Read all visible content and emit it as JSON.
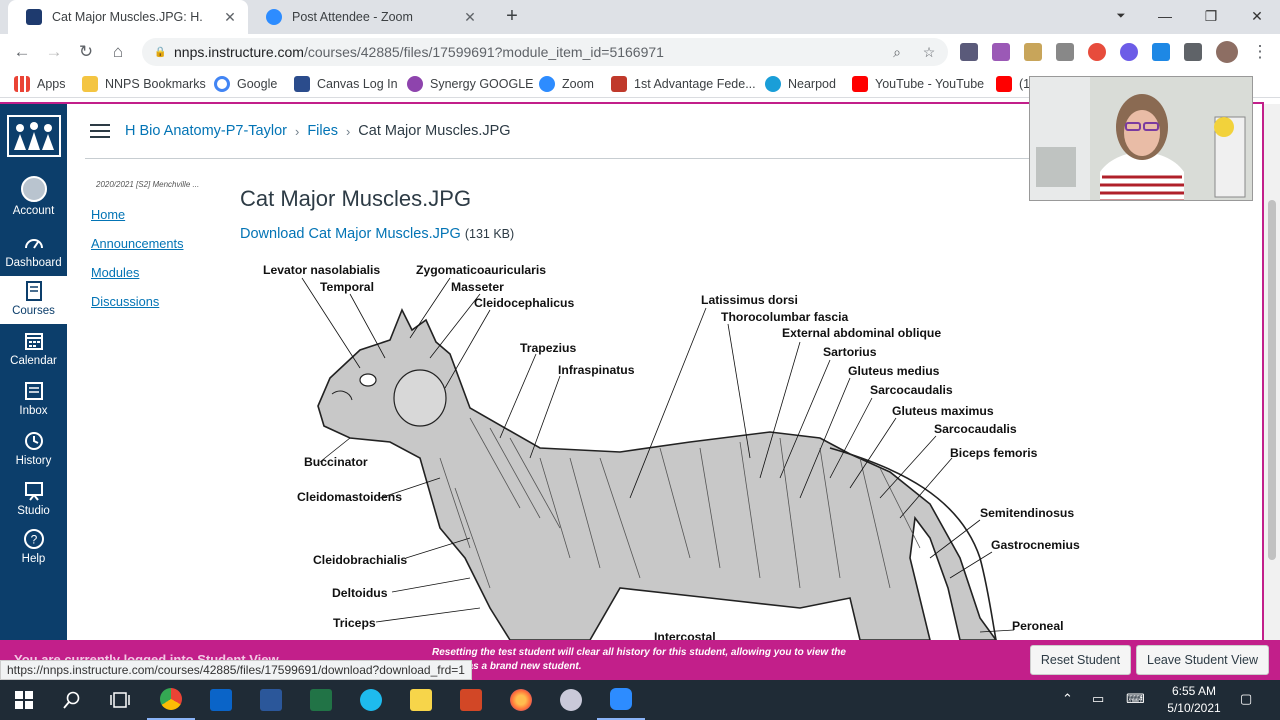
{
  "browser": {
    "tabs": [
      {
        "title": "Cat Major Muscles.JPG: H.Anaton",
        "active": true,
        "icon": "canvas-favicon"
      },
      {
        "title": "Post Attendee - Zoom",
        "active": false,
        "icon": "zoom-favicon"
      }
    ],
    "new_tab": "+",
    "window": {
      "minimize": "—",
      "restore": "❐",
      "close": "✕"
    },
    "url_host": "nnps.instructure.com",
    "url_path": "/courses/42885/files/17599691?module_item_id=5166971",
    "bookmarks": [
      {
        "label": "Apps",
        "color": "#ea4335"
      },
      {
        "label": "NNPS Bookmarks",
        "color": "#f4c542"
      },
      {
        "label": "Google",
        "color": "#4285f4"
      },
      {
        "label": "Canvas Log In",
        "color": "#2b4c8c"
      },
      {
        "label": "Synergy GOOGLE",
        "color": "#8e44ad"
      },
      {
        "label": "Zoom",
        "color": "#2d8cff"
      },
      {
        "label": "1st Advantage Fede...",
        "color": "#c0392b"
      },
      {
        "label": "Nearpod",
        "color": "#1a9ed8"
      },
      {
        "label": "YouTube - YouTube",
        "color": "#ff0000"
      },
      {
        "label": "(1",
        "color": "#ff0000"
      }
    ]
  },
  "global_nav": [
    {
      "label": "Account",
      "icon": "account-avatar-icon"
    },
    {
      "label": "Dashboard",
      "icon": "dashboard-icon"
    },
    {
      "label": "Courses",
      "icon": "courses-icon",
      "active": true
    },
    {
      "label": "Calendar",
      "icon": "calendar-icon"
    },
    {
      "label": "Inbox",
      "icon": "inbox-icon"
    },
    {
      "label": "History",
      "icon": "history-icon"
    },
    {
      "label": "Studio",
      "icon": "studio-icon"
    },
    {
      "label": "Help",
      "icon": "help-icon"
    }
  ],
  "breadcrumbs": {
    "course": "H Bio Anatomy-P7-Taylor",
    "section": "Files",
    "current": "Cat Major Muscles.JPG",
    "separator": "›"
  },
  "course_nav": {
    "term": "2020/2021 [S2] Menchville ...",
    "items": [
      "Home",
      "Announcements",
      "Modules",
      "Discussions"
    ]
  },
  "file": {
    "title": "Cat Major Muscles.JPG",
    "download_label": "Download Cat Major Muscles.JPG",
    "size": "(131 KB)"
  },
  "muscle_labels": [
    "Levator nasolabialis",
    "Temporal",
    "Zygomaticoauricularis",
    "Masseter",
    "Cleidocephalicus",
    "Trapezius",
    "Infraspinatus",
    "Buccinator",
    "Cleidomastoidens",
    "Cleidobrachialis",
    "Deltoidus",
    "Triceps",
    "Intercostal",
    "Latissimus dorsi",
    "Thorocolumbar fascia",
    "External abdominal oblique",
    "Sartorius",
    "Gluteus medius",
    "Sarcocaudalis",
    "Gluteus maximus",
    "Sarcocaudalis",
    "Biceps femoris",
    "Semitendinosus",
    "Gastrocnemius",
    "Peroneal"
  ],
  "student_view": {
    "ghost_text": "You are currently logged into Student View",
    "message": "Resetting the test student will clear all history for this student, allowing you to view the course as a brand new student.",
    "reset_button": "Reset Student",
    "leave_button": "Leave Student View"
  },
  "status_url": "https://nnps.instructure.com/courses/42885/files/17599691/download?download_frd=1",
  "taskbar": {
    "time": "6:55 AM",
    "date": "5/10/2021",
    "apps": [
      {
        "name": "start",
        "color": "#ffffff"
      },
      {
        "name": "search",
        "color": "#ffffff"
      },
      {
        "name": "task-view",
        "color": "#ffffff"
      },
      {
        "name": "chrome",
        "color": "#4285f4"
      },
      {
        "name": "outlook",
        "color": "#0a64c8"
      },
      {
        "name": "word",
        "color": "#2b579a"
      },
      {
        "name": "excel",
        "color": "#217346"
      },
      {
        "name": "internet-explorer",
        "color": "#1ebbee"
      },
      {
        "name": "sticky-notes",
        "color": "#f7d54a"
      },
      {
        "name": "powerpoint",
        "color": "#d24726"
      },
      {
        "name": "firefox",
        "color": "#ff7139"
      },
      {
        "name": "snipping-tool",
        "color": "#c9c9d9"
      },
      {
        "name": "zoom",
        "color": "#2d8cff"
      }
    ]
  },
  "colors": {
    "canvas_nav": "#0c3e6b",
    "link": "#0374b5",
    "student_view": "#c21f8a"
  }
}
